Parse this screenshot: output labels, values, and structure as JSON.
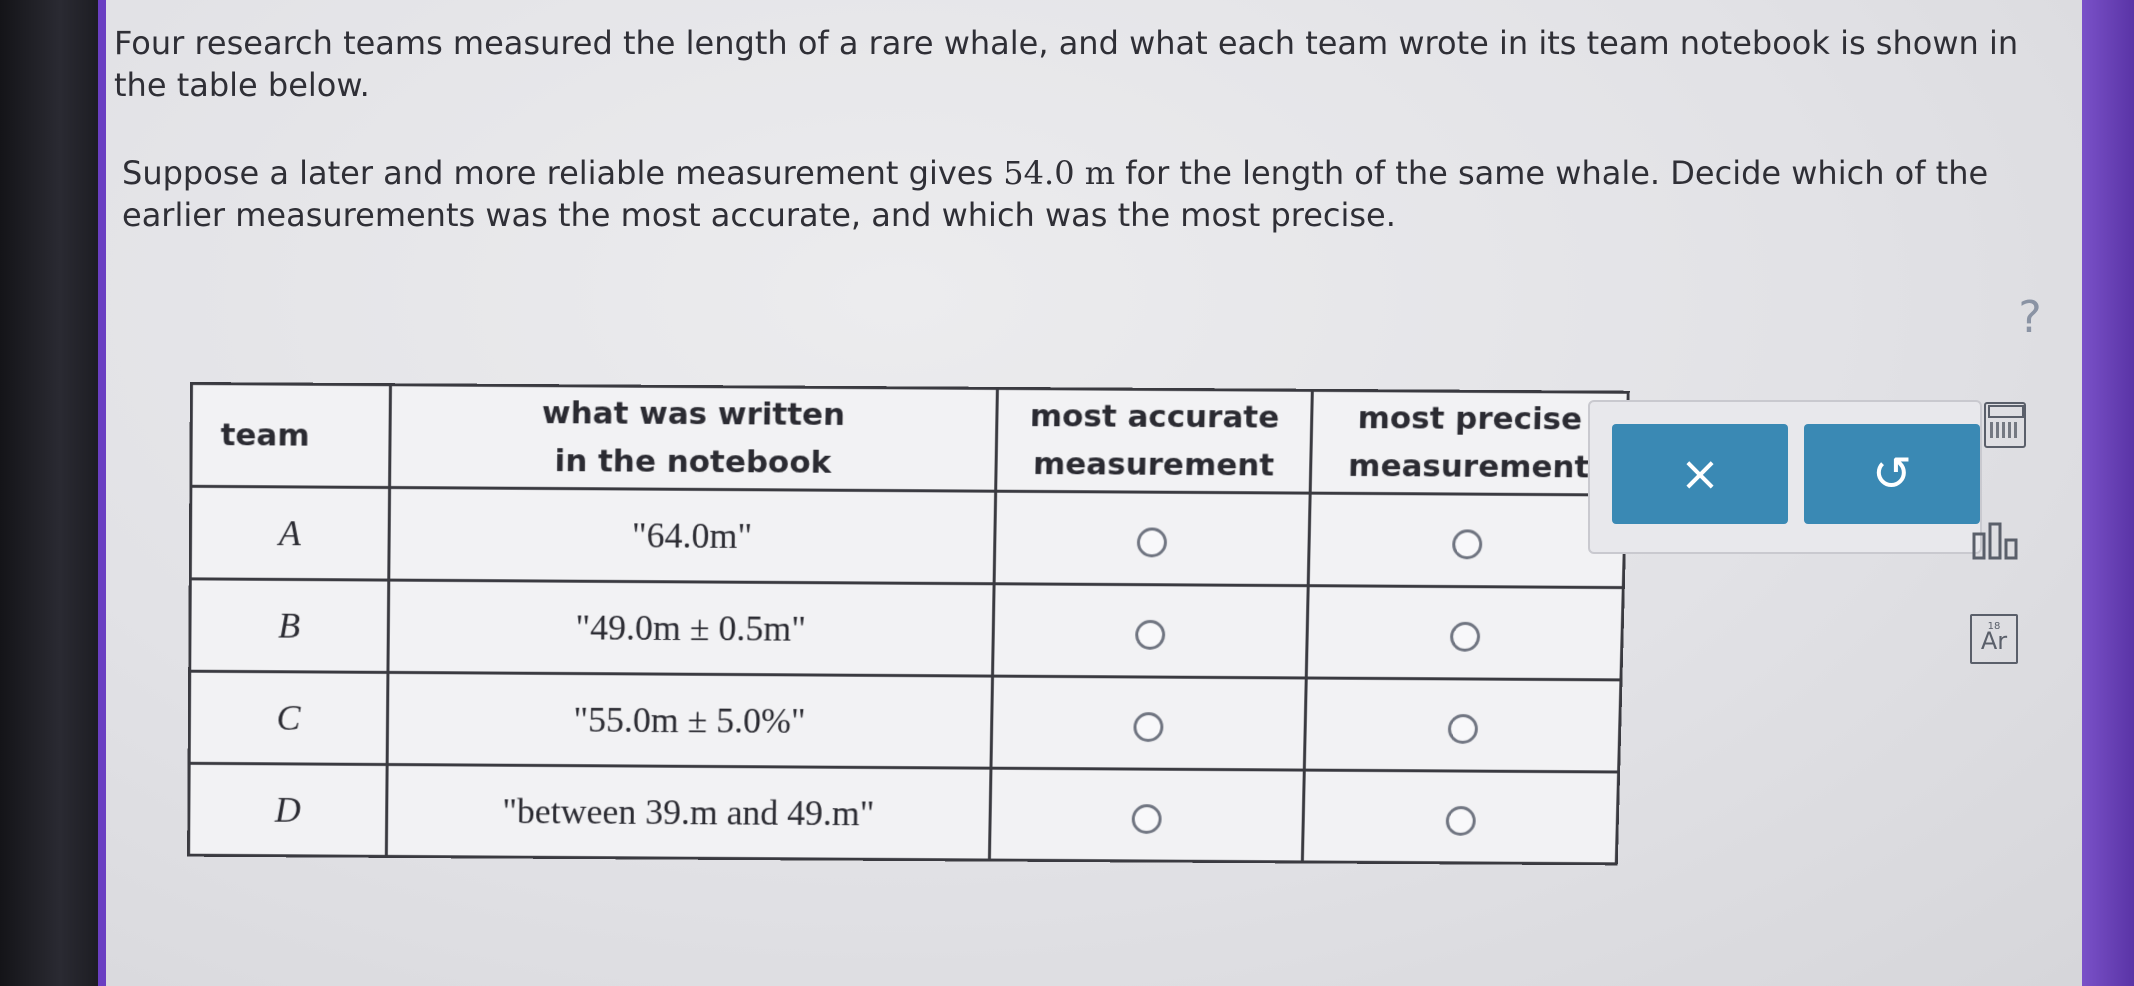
{
  "prompt": {
    "paragraph1": "Four research teams measured the length of a rare whale, and what each team wrote in its team notebook is shown in the table below.",
    "paragraph2_before": "Suppose a later and more reliable measurement gives ",
    "paragraph2_value": "54.0 m",
    "paragraph2_after": " for the length of the same whale. Decide which of the earlier measurements was the most accurate, and which was the most precise."
  },
  "table": {
    "headers": {
      "team": "team",
      "written_line1": "what was written",
      "written_line2": "in the notebook",
      "accurate_line1": "most accurate",
      "accurate_line2": "measurement",
      "precise_line1": "most precise",
      "precise_line2": "measurement"
    },
    "rows": [
      {
        "team": "A",
        "written": "\"64.0m\""
      },
      {
        "team": "B",
        "written": "\"49.0m ± 0.5m\""
      },
      {
        "team": "C",
        "written": "\"55.0m ± 5.0%\""
      },
      {
        "team": "D",
        "written": "\"between 39.m and 49.m\""
      }
    ]
  },
  "actions": {
    "clear_label": "×",
    "undo_label": "↺"
  },
  "tools": {
    "help_label": "?",
    "periodic_symbol": "Ar",
    "periodic_number": "18",
    "data_label": "ılı"
  }
}
